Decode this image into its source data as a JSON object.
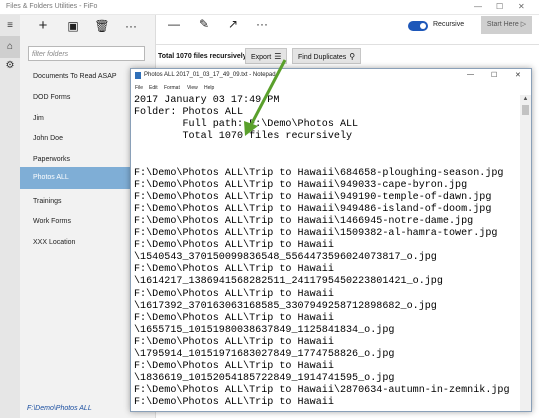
{
  "window": {
    "title": "Files & Folders Utilities - FiFo",
    "minimize_glyph": "—",
    "maximize_glyph": "☐",
    "close_glyph": "✕"
  },
  "rail": {
    "menu_glyph": "≡",
    "home_glyph": "⌂",
    "settings_glyph": "⚙"
  },
  "folder_toolbar": {
    "add_glyph": "+",
    "save_glyph": "▣",
    "delete_glyph": "🗑",
    "more_glyph": "···"
  },
  "filter": {
    "placeholder": "filter folders"
  },
  "folders": [
    "Documents To Read ASAP",
    "DOD Forms",
    "Jim",
    "John Doe",
    "Paperworks",
    "Photos ALL",
    "Trainings",
    "Work Forms",
    "XXX Location"
  ],
  "active_folder": "Photos ALL",
  "status_path": "F:\\Demo\\Photos ALL",
  "right_toolbar": {
    "line_glyph": "—",
    "edit_glyph": "✎",
    "open_glyph": "↗",
    "more_glyph": "···",
    "recursive_label": "Recursive",
    "start_here_label": "Start Here",
    "start_here_glyph": "▷"
  },
  "summary": "Total 1070 files recursively",
  "export_label": "Export",
  "export_glyph": "☰",
  "find_duplicates_label": "Find Duplicates",
  "find_glyph": "⚲",
  "notepad": {
    "title": "Photos ALL 2017_01_03_17_49_09.txt - Notepad",
    "menu": [
      "File",
      "Edit",
      "Format",
      "View",
      "Help"
    ],
    "lines": [
      "2017 January 03 17:49 PM",
      "Folder: Photos ALL",
      "        Full path: F:\\Demo\\Photos ALL",
      "        Total 1070 files recursively",
      "",
      "",
      "F:\\Demo\\Photos ALL\\Trip to Hawaii\\684658-ploughing-season.jpg",
      "F:\\Demo\\Photos ALL\\Trip to Hawaii\\949033-cape-byron.jpg",
      "F:\\Demo\\Photos ALL\\Trip to Hawaii\\949190-temple-of-dawn.jpg",
      "F:\\Demo\\Photos ALL\\Trip to Hawaii\\949486-island-of-doom.jpg",
      "F:\\Demo\\Photos ALL\\Trip to Hawaii\\1466945-notre-dame.jpg",
      "F:\\Demo\\Photos ALL\\Trip to Hawaii\\1509382-al-hamra-tower.jpg",
      "F:\\Demo\\Photos ALL\\Trip to Hawaii",
      "\\1540543_370150099836548_5564473596024073817_o.jpg",
      "F:\\Demo\\Photos ALL\\Trip to Hawaii",
      "\\1614217_1386941568282511_2411795450223801421_o.jpg",
      "F:\\Demo\\Photos ALL\\Trip to Hawaii",
      "\\1617392_370163063168585_3307949258712898682_o.jpg",
      "F:\\Demo\\Photos ALL\\Trip to Hawaii",
      "\\1655715_10151980038637849_1125841834_o.jpg",
      "F:\\Demo\\Photos ALL\\Trip to Hawaii",
      "\\1795914_10151971683027849_1774758826_o.jpg",
      "F:\\Demo\\Photos ALL\\Trip to Hawaii",
      "\\1836619_10152054185722849_1914741595_o.jpg",
      "F:\\Demo\\Photos ALL\\Trip to Hawaii\\2870634-autumn-in-zemnik.jpg",
      "F:\\Demo\\Photos ALL\\Trip to Hawaii"
    ]
  },
  "colors": {
    "accent": "#1d57b9",
    "selection": "#7faed6",
    "arrow": "#5aa02c",
    "status_link": "#1a4ea0"
  }
}
